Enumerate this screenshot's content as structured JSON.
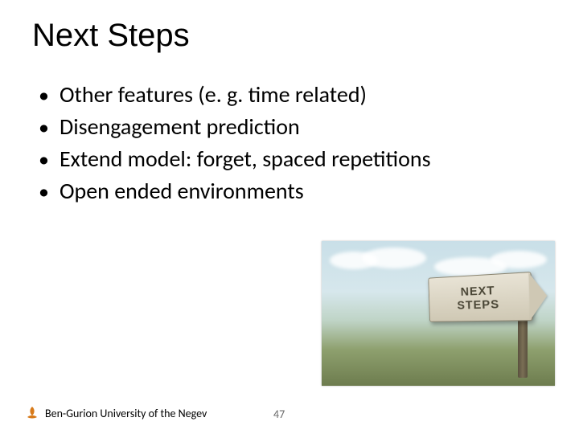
{
  "title": "Next Steps",
  "bullets": [
    "Other features (e. g. time related)",
    "Disengagement prediction",
    "Extend model: forget, spaced repetitions",
    "Open ended environments"
  ],
  "sign": {
    "line1": "NEXT",
    "line2": "STEPS"
  },
  "footer": {
    "university": "Ben-Gurion University of the Negev",
    "page": "47"
  }
}
